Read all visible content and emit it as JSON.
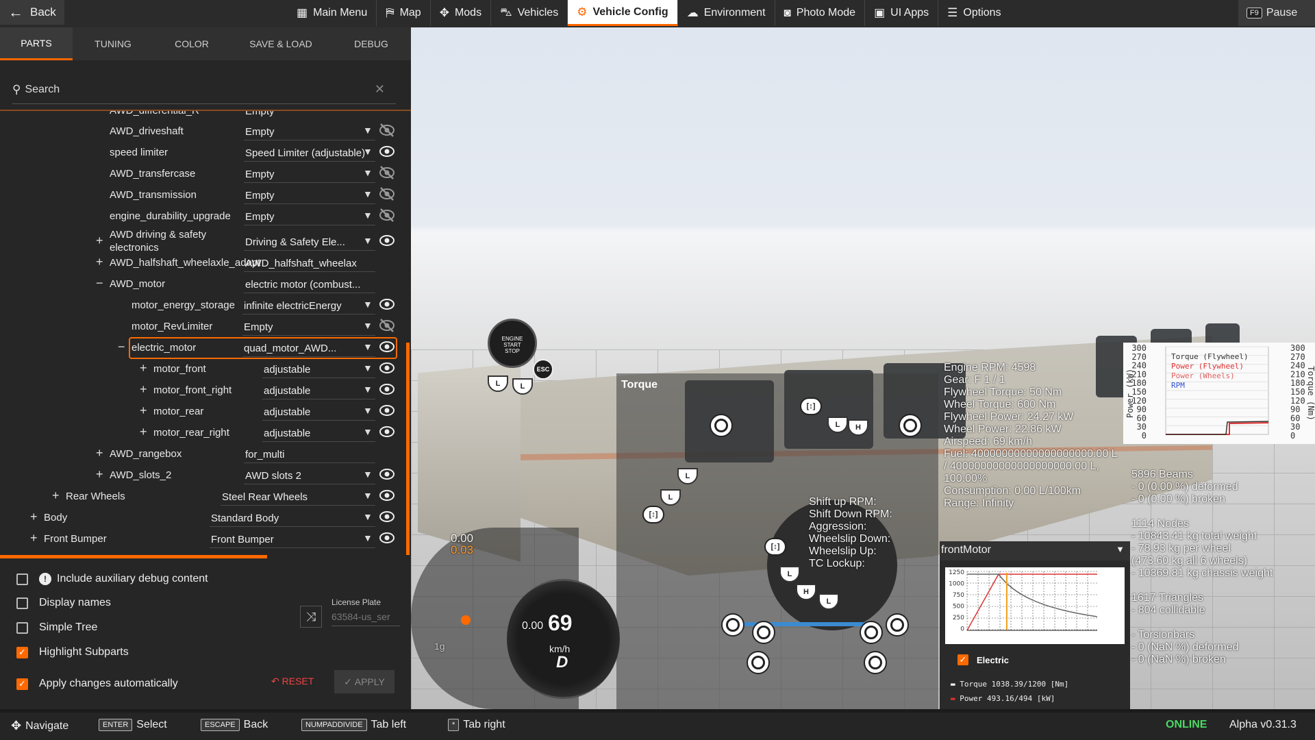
{
  "topbar": {
    "back_label": "Back",
    "nav": [
      {
        "label": "Main Menu",
        "icon": "main-menu-icon",
        "glyph": "▦"
      },
      {
        "label": "Map",
        "icon": "map-icon",
        "glyph": "⛿"
      },
      {
        "label": "Mods",
        "icon": "mods-icon",
        "glyph": "✥"
      },
      {
        "label": "Vehicles",
        "icon": "car-icon",
        "glyph": "⛍"
      },
      {
        "label": "Vehicle Config",
        "icon": "engine-icon",
        "glyph": "⚙",
        "active": true
      },
      {
        "label": "Environment",
        "icon": "weather-icon",
        "glyph": "☁"
      },
      {
        "label": "Photo Mode",
        "icon": "camera-icon",
        "glyph": "◙"
      },
      {
        "label": "UI Apps",
        "icon": "ui-apps-icon",
        "glyph": "▣"
      },
      {
        "label": "Options",
        "icon": "options-icon",
        "glyph": "☰"
      }
    ],
    "pause_key": "F9",
    "pause_label": "Pause"
  },
  "tabs": [
    "PARTS",
    "TUNING",
    "COLOR",
    "SAVE & LOAD",
    "DEBUG"
  ],
  "active_tab": "PARTS",
  "search": {
    "label": "Search"
  },
  "tree": [
    {
      "name": "AWD_driveshaft",
      "value": "Empty",
      "indent": 2,
      "plus": "",
      "visible": false
    },
    {
      "name": "speed limiter",
      "value": "Speed Limiter (adjustable)",
      "indent": 2,
      "plus": "",
      "visible": true
    },
    {
      "name": "AWD_transfercase",
      "value": "Empty",
      "indent": 2,
      "plus": "",
      "visible": false
    },
    {
      "name": "AWD_transmission",
      "value": "Empty",
      "indent": 2,
      "plus": "",
      "visible": false
    },
    {
      "name": "engine_durability_upgrade",
      "value": "Empty",
      "indent": 2,
      "plus": "",
      "visible": false
    },
    {
      "name": "AWD driving & safety electronics",
      "value": "Driving & Safety Ele...",
      "indent": 2,
      "plus": "+",
      "visible": true
    },
    {
      "name": "AWD_halfshaft_wheelaxle_adapt",
      "value": "AWD_halfshaft_wheelax",
      "indent": 2,
      "plus": "+",
      "visible": null
    },
    {
      "name": "AWD_motor",
      "value": "electric motor (combust...",
      "indent": 2,
      "plus": "−",
      "visible": null
    },
    {
      "name": "motor_energy_storage",
      "value": "infinite electricEnergy",
      "indent": 3,
      "plus": "",
      "visible": true
    },
    {
      "name": "motor_RevLimiter",
      "value": "Empty",
      "indent": 3,
      "plus": "",
      "visible": false
    },
    {
      "name": "electric_motor",
      "value": "quad_motor_AWD...",
      "indent": 3,
      "plus": "−",
      "visible": true,
      "selected": true
    },
    {
      "name": "motor_front",
      "value": "adjustable",
      "indent": 4,
      "plus": "+",
      "visible": true
    },
    {
      "name": "motor_front_right",
      "value": "adjustable",
      "indent": 4,
      "plus": "+",
      "visible": true
    },
    {
      "name": "motor_rear",
      "value": "adjustable",
      "indent": 4,
      "plus": "+",
      "visible": true
    },
    {
      "name": "motor_rear_right",
      "value": "adjustable",
      "indent": 4,
      "plus": "+",
      "visible": true
    },
    {
      "name": "AWD_rangebox",
      "value": "for_multi",
      "indent": 2,
      "plus": "+",
      "visible": null
    },
    {
      "name": "AWD_slots_2",
      "value": "AWD slots 2",
      "indent": 2,
      "plus": "+",
      "visible": true
    },
    {
      "name": "Rear Wheels",
      "value": "Steel Rear Wheels",
      "indent": 1,
      "plus": "+",
      "visible": true
    },
    {
      "name": "Body",
      "value": "Standard Body",
      "indent": 0,
      "plus": "+",
      "visible": true
    },
    {
      "name": "Front Bumper",
      "value": "Front Bumper",
      "indent": 0,
      "plus": "+",
      "visible": true
    }
  ],
  "tree_partial_top": {
    "name": "AWD_differential_R",
    "value": "Empty"
  },
  "options": {
    "include_aux": {
      "label": "Include auxiliary debug content",
      "checked": false
    },
    "display_names": {
      "label": "Display names",
      "checked": false
    },
    "simple_tree": {
      "label": "Simple Tree",
      "checked": false
    },
    "highlight_subparts": {
      "label": "Highlight Subparts",
      "checked": true
    },
    "apply_auto": {
      "label": "Apply changes automatically",
      "checked": true
    }
  },
  "license_plate": {
    "label": "License Plate",
    "value": "63584-us_ser"
  },
  "buttons": {
    "reset": "RESET",
    "apply": "APPLY"
  },
  "bottombar": {
    "hints": [
      {
        "key": "",
        "label": "Navigate"
      },
      {
        "key": "ENTER",
        "label": "Select"
      },
      {
        "key": "ESCAPE",
        "label": "Back"
      },
      {
        "key": "NUMPADDIVIDE",
        "label": "Tab left"
      },
      {
        "key": "*",
        "label": "Tab right"
      }
    ],
    "status": "ONLINE",
    "version": "Alpha v0.31.3"
  },
  "hud": {
    "torque_title": "Torque",
    "engine_lines": [
      "Engine RPM: 4598",
      "Gear: F 1 / 1",
      "Flywheel Torque: 50 Nm",
      "Wheel Torque: 600 Nm",
      "Flywheel Power: 24.27 kW",
      "Wheel Power: 22.86 kW",
      "Airspeed: 69 km/h",
      "Fuel: 40000000000000000000.00 L",
      "/ 40000000000000000000.00 L,",
      "100.00%",
      "Consumption: 0.00 L/100km",
      "Range: Infinity"
    ],
    "shift_lines": [
      "Shift up RPM:",
      "Shift Down RPM:",
      "Aggression:",
      "Wheelslip Down:",
      "Wheelslip Up:",
      "TC Lockup:"
    ],
    "beam_lines": [
      "5896 Beams",
      "- 0 (0.00 %) deformed",
      "- 0 (0.00 %) broken",
      "",
      "1114 Nodes",
      "- 10843.41 kg total weight",
      "- 78.93 kg per wheel",
      "(473.60 kg all 6 wheels)",
      "- 10369.81 kg chassis weight",
      "",
      "1617 Triangles",
      "- 804 collidable",
      "",
      "- Torsionbars",
      "- 0 (NaN %) deformed",
      "- 0 (NaN %) broken"
    ],
    "start_stop": [
      "ENGINE",
      "START",
      "STOP"
    ],
    "esc": "ESC",
    "speed": {
      "top": "0.00",
      "sub": "0.03",
      "value": "69",
      "unit": "km/h",
      "gear": "D",
      "g": "1g"
    },
    "minigraph": {
      "left_ticks": [
        "300",
        "270",
        "240",
        "210",
        "180",
        "150",
        "120",
        "90",
        "60",
        "30",
        "0"
      ],
      "right_ticks": [
        "300",
        "270",
        "240",
        "210",
        "180",
        "150",
        "120",
        "90",
        "60",
        "30",
        "0"
      ],
      "left_axis": "Power (kW)",
      "right_axis": "Torque (Nm)",
      "legend": [
        {
          "label": "Torque (Flywheel)",
          "color": "#333333"
        },
        {
          "label": "Power (Flywheel)",
          "color": "#e03030"
        },
        {
          "label": "Power (Wheels)",
          "color": "#e06060"
        },
        {
          "label": "RPM",
          "color": "#3050d0"
        }
      ]
    },
    "motor": {
      "select": "frontMotor",
      "electric_label": "Electric",
      "electric_checked": true,
      "torque_label": "Torque",
      "torque_value": "1038.39/1200",
      "torque_unit": "[Nm]",
      "power_label": "Power",
      "power_value": "493.16/494",
      "power_unit": "[kW]",
      "y_ticks": [
        "1250",
        "1000",
        "750",
        "500",
        "250",
        "0"
      ]
    }
  },
  "colors": {
    "accent": "#ff6a00",
    "online": "#4cd964",
    "danger": "#e44444"
  }
}
